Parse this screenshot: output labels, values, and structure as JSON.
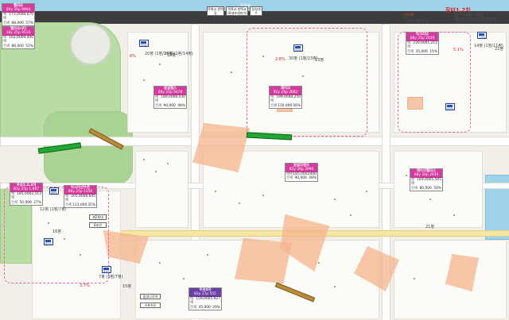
{
  "map": {
    "title": "장미1,2차",
    "expressway_label": "한택로",
    "top_tags": [
      {
        "id": "t1",
        "lines": "목록교 한택동"
      },
      {
        "id": "t2",
        "lines": "목록교 한택교 (롯데프레미아)"
      },
      {
        "id": "t3",
        "lines": "잠실대 수"
      }
    ],
    "right_info": {
      "line1": "신도계",
      "line2": "사업시행 인가",
      "line3": "3년 도계질종 진행중",
      "line4": "재건축 조합설립 인가 진행 중"
    },
    "cards": [
      {
        "id": "c1",
        "name": "헬리오",
        "spec": "09y 26p 9904",
        "rows": [
          [
            "매매",
            "173,000",
            "8,070"
          ],
          [
            "전세",
            "88,000",
            "57%"
          ]
        ],
        "color": "#d63ca0"
      },
      {
        "id": "c2",
        "name": "헬리오시티",
        "spec": "18y 25p 9510",
        "rows": [
          [
            "매매",
            "162,000",
            "9,400"
          ],
          [
            "전세",
            "86,000",
            "52%"
          ]
        ],
        "color": "#d63ca0"
      },
      {
        "id": "c3",
        "name": "잠실엘스",
        "spec": "08y 25p 5678",
        "rows": [
          [
            "매매",
            "189,000",
            "8,030"
          ],
          [
            "전세",
            "90,000",
            "48%"
          ]
        ],
        "color": "#d63ca0"
      },
      {
        "id": "c4",
        "name": "레이크",
        "spec": "92y 24p 3002",
        "rows": [
          [
            "매매",
            "199,000",
            "8,250"
          ],
          [
            "전세",
            "110,000",
            "56%"
          ]
        ],
        "color": "#d63ca0"
      },
      {
        "id": "c5",
        "name": "잠실리센츠",
        "spec": "82y 26p 3990",
        "rows": [
          [
            "매매",
            "185,000",
            "2400"
          ],
          [
            "전세",
            "90,000",
            "49%"
          ]
        ],
        "color": "#d63ca0"
      },
      {
        "id": "c6",
        "name": "파크리오",
        "spec": "08y 25p 2039",
        "rows": [
          [
            "매매",
            "230,000",
            "1,212"
          ],
          [
            "전세",
            "35,000",
            "15%"
          ]
        ],
        "color": "#d63ca0"
      },
      {
        "id": "c7",
        "name": "레이크팰리스",
        "spec": "08y 28p 2039",
        "rows": [
          [
            "매매",
            "169,000",
            "5,505"
          ],
          [
            "전세",
            "80,000",
            "50%"
          ]
        ],
        "color": "#d63ca0"
      },
      {
        "id": "c8",
        "name": "우성1,2,3차",
        "spec": "81y 25p 1,087",
        "rows": [
          [
            "매매",
            "185,000",
            "2,113"
          ],
          [
            "전세",
            "50,000",
            "27%"
          ]
        ],
        "color": "#d63ca0"
      },
      {
        "id": "c9",
        "name": "아시아선수촌",
        "spec": "86y 25p 1356",
        "rows": [
          [
            "매매",
            "205,000",
            "8,045"
          ],
          [
            "전세",
            "113,000",
            "35%"
          ]
        ],
        "color": "#d63ca0"
      },
      {
        "id": "c10",
        "name": "우성4차",
        "spec": "83y 27p 555",
        "rows": [
          [
            "매매",
            "159,000",
            "5,927"
          ],
          [
            "전세",
            "45,000",
            "29%"
          ]
        ],
        "color": "#6a3fa6"
      }
    ],
    "road_tags": [
      {
        "id": "r1",
        "text": "제2롯데"
      },
      {
        "id": "r2",
        "text": "8호선"
      },
      {
        "id": "r3",
        "text": "잠실나루역"
      },
      {
        "id": "r4",
        "text": "스포츠유"
      }
    ],
    "markers": [
      {
        "id": "m1",
        "text": "99%"
      },
      {
        "id": "m2",
        "text": "93%"
      },
      {
        "id": "m3",
        "text": "73%"
      },
      {
        "id": "m4",
        "text": "86%"
      },
      {
        "id": "m5",
        "text": "83%"
      },
      {
        "id": "m6",
        "text": "82%"
      },
      {
        "id": "m7",
        "text": "99%"
      }
    ],
    "small_labels": [
      {
        "id": "s1",
        "text": "20평 (1평/14평)"
      },
      {
        "id": "s2",
        "text": "25평 (1평/14평)"
      },
      {
        "id": "s3",
        "text": "30평 (1평/23평)"
      },
      {
        "id": "s4",
        "text": "14평 (1평/11평)"
      },
      {
        "id": "s5",
        "text": "12평 (1평/7평)"
      },
      {
        "id": "s6",
        "text": "7평 (3평/7평)"
      },
      {
        "id": "s7",
        "text": "6%"
      },
      {
        "id": "s8",
        "text": "3.7%"
      },
      {
        "id": "s9",
        "text": "5.1%"
      },
      {
        "id": "s10",
        "text": "2.8%"
      },
      {
        "id": "s11",
        "text": "21평"
      },
      {
        "id": "s12",
        "text": "15평"
      },
      {
        "id": "s13",
        "text": "18평"
      },
      {
        "id": "s14",
        "text": "13평"
      },
      {
        "id": "s15",
        "text": "16평"
      },
      {
        "id": "s16",
        "text": "21평"
      }
    ]
  }
}
